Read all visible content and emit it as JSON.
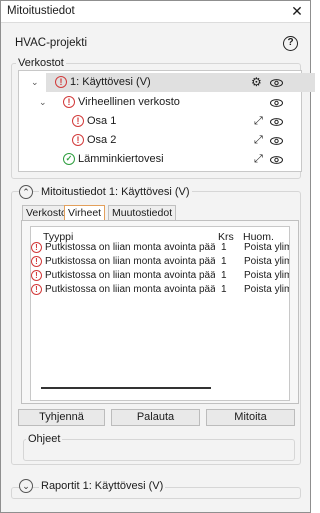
{
  "window": {
    "title": "Mitoitustiedot",
    "close_glyph": "✕"
  },
  "project": {
    "label": "HVAC-projekti",
    "help_glyph": "?"
  },
  "networks": {
    "group_label": "Verkostot",
    "items": [
      {
        "label": "1: Käyttövesi (V)",
        "status": "error"
      },
      {
        "label": "Virheellinen verkosto",
        "status": "error"
      },
      {
        "label": "Osa 1",
        "status": "error"
      },
      {
        "label": "Osa 2",
        "status": "error"
      },
      {
        "label": "Lämminkiertovesi",
        "status": "ok"
      }
    ]
  },
  "details": {
    "header": "Mitoitustiedot  1: Käyttövesi (V)",
    "tabs": [
      {
        "label": "Verkosto"
      },
      {
        "label": "Virheet",
        "active": true
      },
      {
        "label": "Muutostiedot"
      }
    ],
    "table": {
      "columns": [
        "Tyyppi",
        "Krs",
        "Huom."
      ],
      "rows": [
        {
          "type": "Putkistossa on liian monta avointa päätä",
          "floor": "1",
          "note": "Poista ylim"
        },
        {
          "type": "Putkistossa on liian monta avointa päätä",
          "floor": "1",
          "note": "Poista ylim"
        },
        {
          "type": "Putkistossa on liian monta avointa päätä",
          "floor": "1",
          "note": "Poista ylim"
        },
        {
          "type": "Putkistossa on liian monta avointa päätä",
          "floor": "1",
          "note": "Poista ylim"
        }
      ]
    },
    "buttons": {
      "clear": "Tyhjennä",
      "restore": "Palauta",
      "size": "Mitoita"
    },
    "instructions_label": "Ohjeet"
  },
  "reports": {
    "header": "Raportit  1: Käyttövesi (V)"
  },
  "colors": {
    "error": "#d23b3b",
    "ok": "#2e9e3e",
    "active_tab_border": "#e3a05c"
  },
  "icons": {
    "error": "exclamation-circle-icon",
    "ok": "check-circle-icon",
    "eye": "eye-icon",
    "gear": "gear-icon",
    "expand": "diagonal-arrows-icon"
  }
}
